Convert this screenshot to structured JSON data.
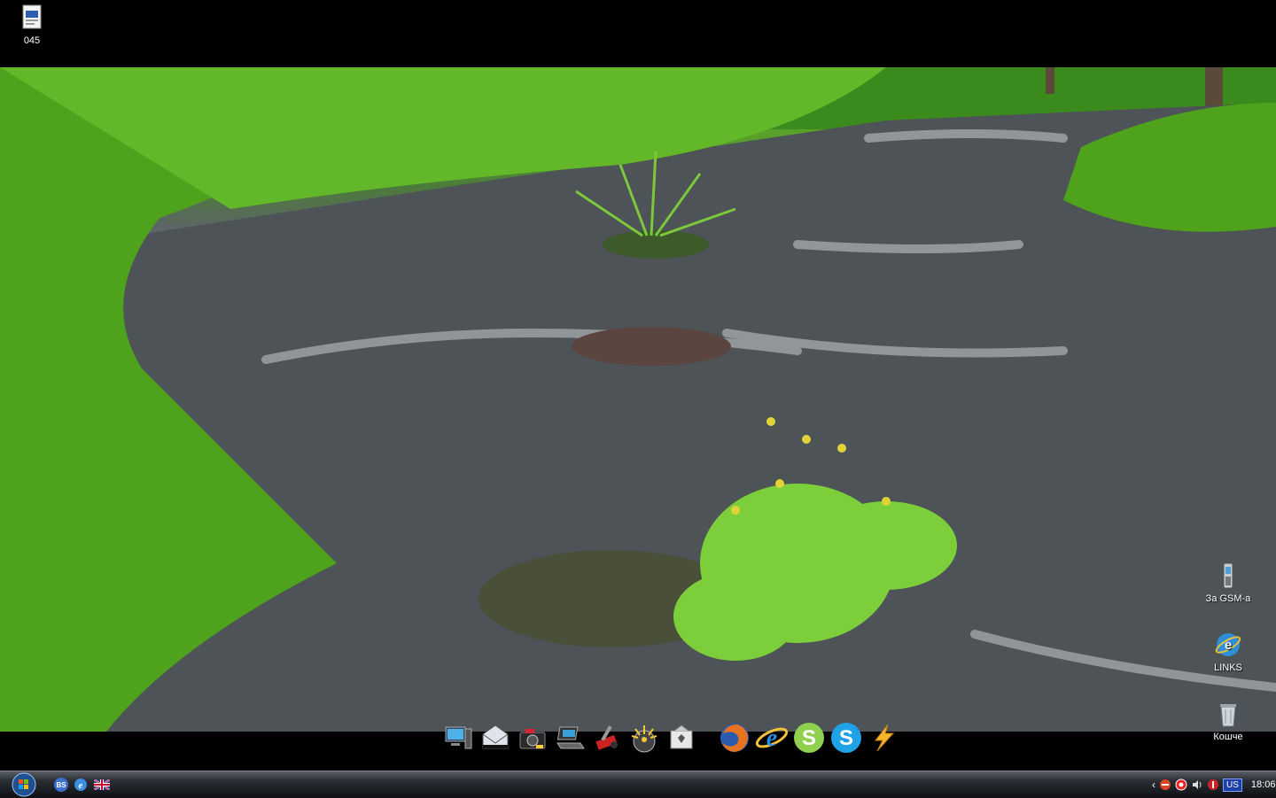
{
  "desktop": {
    "top_left_icons": [
      {
        "label": "045",
        "icon": "document-icon"
      }
    ],
    "right_icons": [
      {
        "label": "За GSM-а",
        "icon": "mobile-phone-icon"
      },
      {
        "label": "LINKS",
        "icon": "internet-globe-icon"
      },
      {
        "label": "Кошче",
        "icon": "recycle-bin-icon"
      }
    ]
  },
  "dock": {
    "items": [
      {
        "icon": "computer-icon"
      },
      {
        "icon": "mail-envelope-icon"
      },
      {
        "icon": "camera-icon"
      },
      {
        "icon": "laptop-icon"
      },
      {
        "icon": "tools-icon"
      },
      {
        "icon": "sunburst-icon"
      },
      {
        "icon": "card-icon"
      },
      {
        "icon": "firefox-icon"
      },
      {
        "icon": "internet-explorer-icon"
      },
      {
        "icon": "skype-green-icon"
      },
      {
        "icon": "skype-blue-icon"
      },
      {
        "icon": "lightning-icon"
      }
    ]
  },
  "taskbar": {
    "quick_launch": [
      {
        "icon": "bs-icon",
        "text": "BS"
      },
      {
        "icon": "internet-explorer-small-icon"
      },
      {
        "icon": "uk-flag-icon"
      }
    ],
    "tray": {
      "language": "US",
      "time": "18:06"
    }
  },
  "colors": {
    "taskbar_top": "#5a5f66",
    "taskbar_bottom": "#0d0f12",
    "language_badge": "#1d3fa8"
  }
}
